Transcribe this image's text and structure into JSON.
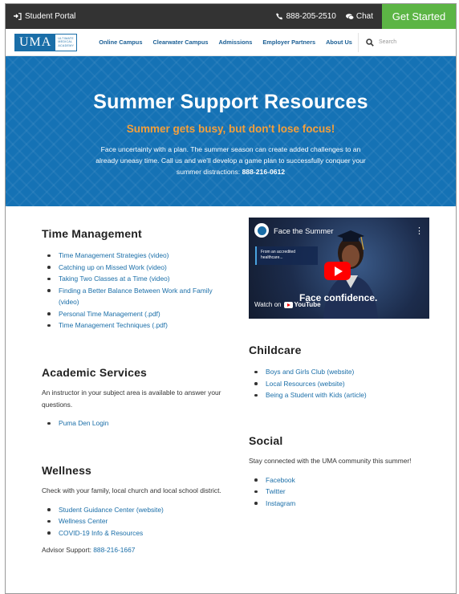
{
  "topbar": {
    "portal_label": "Student Portal",
    "phone": "888-205-2510",
    "chat_label": "Chat",
    "cta_label": "Get Started"
  },
  "logo": {
    "text": "UMA",
    "sub_lines": [
      "ULTIMATE",
      "MEDICAL",
      "ACADEMY"
    ]
  },
  "nav": {
    "items": [
      "Online Campus",
      "Clearwater Campus",
      "Admissions",
      "Employer Partners",
      "About Us"
    ],
    "search_placeholder": "Search"
  },
  "hero": {
    "title": "Summer Support Resources",
    "subtitle": "Summer gets busy, but don't lose focus!",
    "body": "Face uncertainty with a plan. The summer season can create added challenges to an already uneasy time. Call us and we'll develop a game plan to successfully conquer your summer distractions:",
    "phone": "888-216-0612"
  },
  "time_management": {
    "heading": "Time Management",
    "links": [
      "Time Management Strategies (video)",
      "Catching up on Missed Work (video)",
      "Taking Two Classes at a Time (video)",
      "Finding a Better Balance Between Work and Family (video)",
      "Personal Time Management (.pdf)",
      "Time Management Techniques (.pdf)"
    ]
  },
  "academic": {
    "heading": "Academic Services",
    "description": "An instructor in your subject area is available to answer your questions.",
    "links": [
      "Puma Den Login"
    ]
  },
  "wellness": {
    "heading": "Wellness",
    "description": "Check with your family, local church and local school district.",
    "links": [
      "Student Guidance Center (website)",
      "Wellness Center",
      "COVID-19 Info & Resources"
    ],
    "advisor_label": "Advisor Support:",
    "advisor_phone": "888-216-1667"
  },
  "video": {
    "title": "Face the Summer",
    "card_text": "From an accredited healthcare...",
    "tagline": "Face confidence.",
    "watch_on": "Watch on",
    "youtube": "YouTube"
  },
  "childcare": {
    "heading": "Childcare",
    "links": [
      "Boys and Girls Club (website)",
      "Local Resources (website)",
      "Being a Student with Kids (article)"
    ]
  },
  "social": {
    "heading": "Social",
    "description": "Stay connected with the UMA community this summer!",
    "links": [
      "Facebook",
      "Twitter",
      "Instagram"
    ]
  },
  "colors": {
    "hero_blue": "#1572b5",
    "accent_orange": "#f39f3b",
    "cta_green": "#5cb545",
    "link_blue": "#1a6ea8",
    "topbar": "#333333"
  },
  "icons": [
    "login-icon",
    "phone-icon",
    "chat-icon",
    "search-icon",
    "play-icon",
    "youtube-icon",
    "more-icon"
  ]
}
